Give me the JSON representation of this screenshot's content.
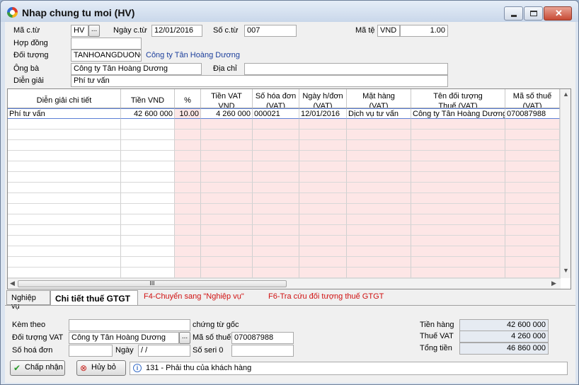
{
  "window": {
    "title": "Nhap chung tu moi (HV)"
  },
  "header": {
    "ma_ct_label": "Mã c.từ",
    "ma_ct": "HV",
    "dots": "...",
    "ngay_ct_label": "Ngày c.từ",
    "ngay_ct": "12/01/2016",
    "so_ct_label": "Số c.từ",
    "so_ct": "007",
    "ma_te_label": "Mã tệ",
    "ma_te": "VND",
    "ty_gia": "1.00",
    "hop_dong_label": "Hợp đồng",
    "hop_dong": "",
    "doi_tuong_label": "Đối tượng",
    "doi_tuong": "TANHOANGDUONG",
    "doi_tuong_name": "Công ty Tân Hoàng Dương",
    "ong_ba_label": "Ông bà",
    "ong_ba": "Công ty Tân Hoàng Dương",
    "dia_chi_label": "Địa chỉ",
    "dia_chi": "",
    "dien_giai_label": "Diễn giải",
    "dien_giai": "Phí tư vấn"
  },
  "grid": {
    "columns": [
      {
        "l1": "Diễn giải chi tiết",
        "l2": ""
      },
      {
        "l1": "Tiền VND",
        "l2": ""
      },
      {
        "l1": "%",
        "l2": ""
      },
      {
        "l1": "Tiền VAT",
        "l2": "VND"
      },
      {
        "l1": "Số hóa đơn",
        "l2": "(VAT)"
      },
      {
        "l1": "Ngày h/đơn",
        "l2": "(VAT)"
      },
      {
        "l1": "Mặt hàng",
        "l2": "(VAT)"
      },
      {
        "l1": "Tên đối tượng",
        "l2": "Thuế (VAT)"
      },
      {
        "l1": "Mã số thuế",
        "l2": "(VAT)"
      }
    ],
    "rows": [
      [
        "Phí tư vấn",
        "42 600 000",
        "10.00",
        "4 260 000",
        "000021",
        "12/01/2016",
        "Dịch vụ tư vấn",
        "Công ty Tân Hoàng Dương",
        "070087988"
      ]
    ],
    "scroll_thumb_label": "III"
  },
  "tabs": [
    {
      "label": "Nghiệp vụ"
    },
    {
      "label": "Chi tiết thuế GTGT"
    }
  ],
  "hints": {
    "f4": "F4-Chuyển sang \"Nghiệp vụ\"",
    "f6": "F6-Tra cứu đối tượng thuế GTGT"
  },
  "vat": {
    "kem_theo_label": "Kèm theo",
    "kem_theo": "",
    "chung_tu_goc": "chứng từ gốc",
    "doi_tuong_vat_label": "Đối tượng VAT",
    "doi_tuong_vat": "Công ty Tân Hoàng Dương",
    "ma_so_thue_label": "Mã số thuế",
    "ma_so_thue": "070087988",
    "so_hoa_don_label": "Số hoá đơn",
    "so_hoa_don": "",
    "ngay_label": "Ngày",
    "ngay": " /  /",
    "so_seri_label": "Số seri 0",
    "so_seri": ""
  },
  "totals": {
    "tien_hang_label": "Tiền hàng",
    "tien_hang": "42 600 000",
    "thue_vat_label": "Thuế VAT",
    "thue_vat": "4 260 000",
    "tong_tien_label": "Tổng tiền",
    "tong_tien": "46 860 000"
  },
  "buttons": {
    "accept": "Chấp nhận",
    "cancel": "Hủy bỏ"
  },
  "status": {
    "text": "131 - Phải thu của khách hàng"
  }
}
